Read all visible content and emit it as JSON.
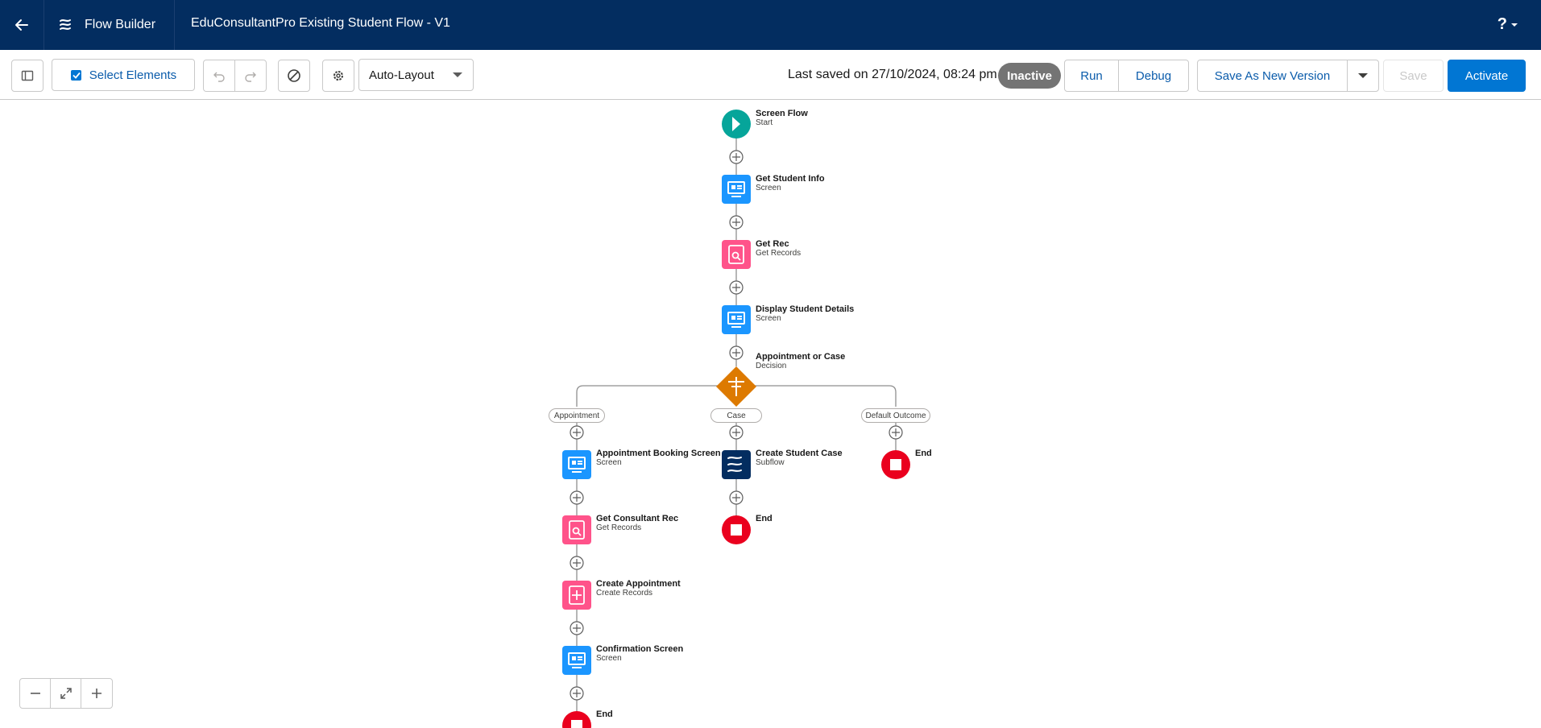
{
  "header": {
    "app_name": "Flow Builder",
    "flow_title": "EduConsultantPro Existing Student Flow - V1",
    "help_label": "?"
  },
  "toolbar": {
    "select_elements_label": "Select Elements",
    "layout_mode": "Auto-Layout",
    "last_saved": "Last saved on 27/10/2024, 08:24 pm",
    "status_badge": "Inactive",
    "run_label": "Run",
    "debug_label": "Debug",
    "save_as_new_version_label": "Save As New Version",
    "save_label": "Save",
    "activate_label": "Activate"
  },
  "flow": {
    "start": {
      "title": "Screen Flow",
      "subtitle": "Start"
    },
    "get_student_info": {
      "title": "Get Student Info",
      "subtitle": "Screen"
    },
    "get_rec": {
      "title": "Get Rec",
      "subtitle": "Get Records"
    },
    "display_student_details": {
      "title": "Display Student Details",
      "subtitle": "Screen"
    },
    "decision": {
      "title": "Appointment or Case",
      "subtitle": "Decision"
    },
    "outcomes": {
      "appointment": "Appointment",
      "case": "Case",
      "default": "Default Outcome"
    },
    "appointment_booking": {
      "title": "Appointment Booking Screen",
      "subtitle": "Screen"
    },
    "get_consultant_rec": {
      "title": "Get Consultant Rec",
      "subtitle": "Get Records"
    },
    "create_appointment": {
      "title": "Create Appointment",
      "subtitle": "Create Records"
    },
    "confirmation_screen": {
      "title": "Confirmation Screen",
      "subtitle": "Screen"
    },
    "end_appointment": {
      "title": "End"
    },
    "create_student_case": {
      "title": "Create Student Case",
      "subtitle": "Subflow"
    },
    "end_case": {
      "title": "End"
    },
    "end_default": {
      "title": "End"
    }
  },
  "colors": {
    "header_bg": "#032d60",
    "brand_blue": "#0176d3",
    "screen_icon": "#1b96ff",
    "records_icon": "#ff538a",
    "decision_icon": "#dd7a01",
    "subflow_icon": "#032d60",
    "start_icon": "#06a59a",
    "end_icon": "#ea001e"
  }
}
